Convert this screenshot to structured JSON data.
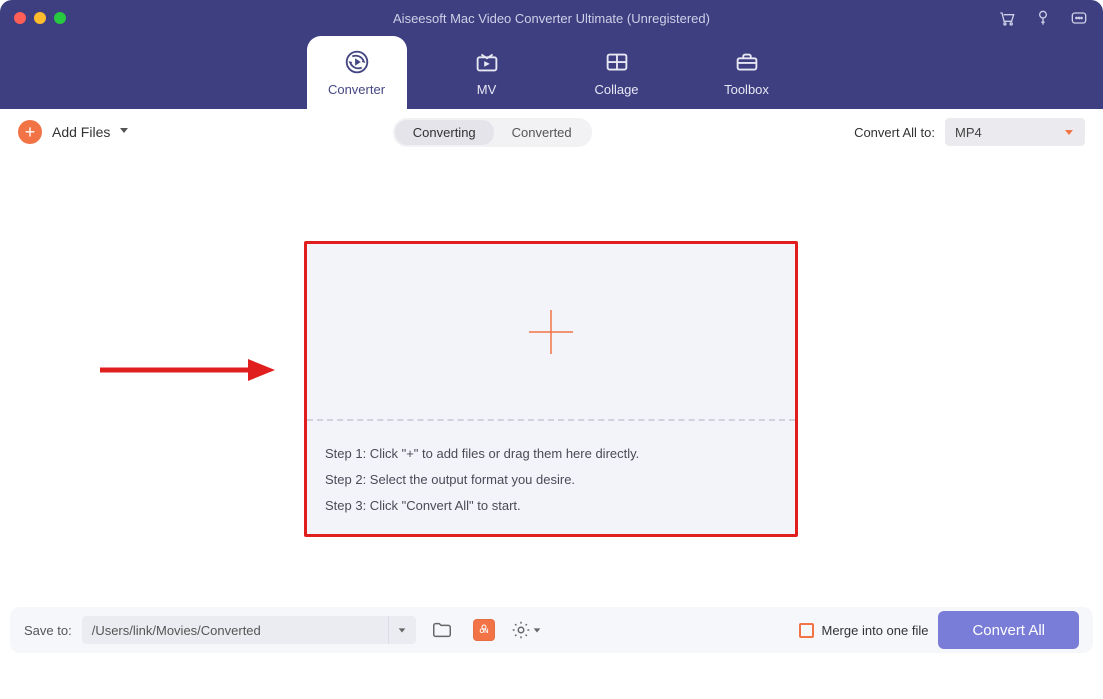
{
  "app": {
    "title": "Aiseesoft Mac Video Converter Ultimate (Unregistered)"
  },
  "tabs": [
    {
      "label": "Converter",
      "active": true,
      "icon": "converter"
    },
    {
      "label": "MV",
      "active": false,
      "icon": "mv"
    },
    {
      "label": "Collage",
      "active": false,
      "icon": "collage"
    },
    {
      "label": "Toolbox",
      "active": false,
      "icon": "toolbox"
    }
  ],
  "toolbar": {
    "addfiles_label": "Add Files",
    "segments": {
      "converting": "Converting",
      "converted": "Converted",
      "active": "converting"
    },
    "convert_all_to_label": "Convert All to:",
    "format_selected": "MP4"
  },
  "dropzone": {
    "step1": "Step 1: Click \"+\" to add files or drag them here directly.",
    "step2": "Step 2: Select the output format you desire.",
    "step3": "Step 3: Click \"Convert All\" to start."
  },
  "bottom": {
    "save_to_label": "Save to:",
    "path": "/Users/link/Movies/Converted",
    "merge_label": "Merge into one file",
    "merge_checked": false,
    "convert_all_label": "Convert All"
  },
  "colors": {
    "brand_dark": "#3d3f80",
    "accent_orange": "#f27346",
    "cta_purple": "#7a7dd8",
    "annotation_red": "#e01e1e"
  }
}
